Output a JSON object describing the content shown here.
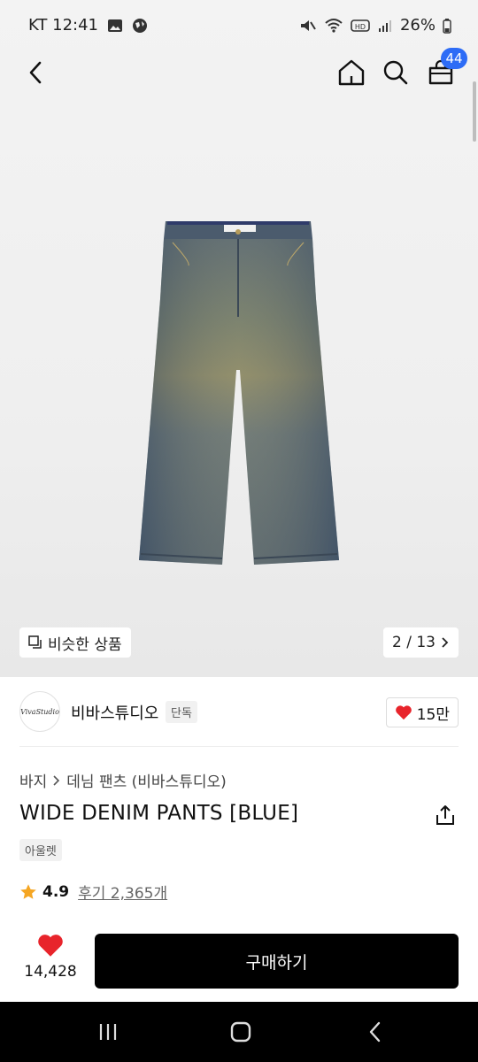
{
  "status_bar": {
    "time": "KT 12:41",
    "battery": "26%"
  },
  "header": {
    "cart_count": "44"
  },
  "gallery": {
    "similar_label": "비슷한 상품",
    "page_indicator": "2 / 13"
  },
  "brand": {
    "logo_text": "VivaStudio",
    "name": "비바스튜디오",
    "tag": "단독",
    "like_count": "15만"
  },
  "product": {
    "breadcrumb": [
      "바지",
      "데님 팬츠 (비바스튜디오)"
    ],
    "title": "WIDE DENIM PANTS [BLUE]",
    "outlet_tag": "아울렛",
    "rating": "4.9",
    "review_label": "후기 2,365개"
  },
  "purchase": {
    "wish_count": "14,428",
    "buy_label": "구매하기"
  },
  "colors": {
    "accent_badge": "#2d6cf6",
    "heart": "#e8242b",
    "star": "#f5a623",
    "buy_button": "#000000"
  },
  "icons": [
    "back-arrow-icon",
    "home-icon",
    "search-icon",
    "shopping-bag-icon",
    "similar-products-icon",
    "chevron-right-icon",
    "heart-icon",
    "share-icon",
    "star-icon"
  ]
}
